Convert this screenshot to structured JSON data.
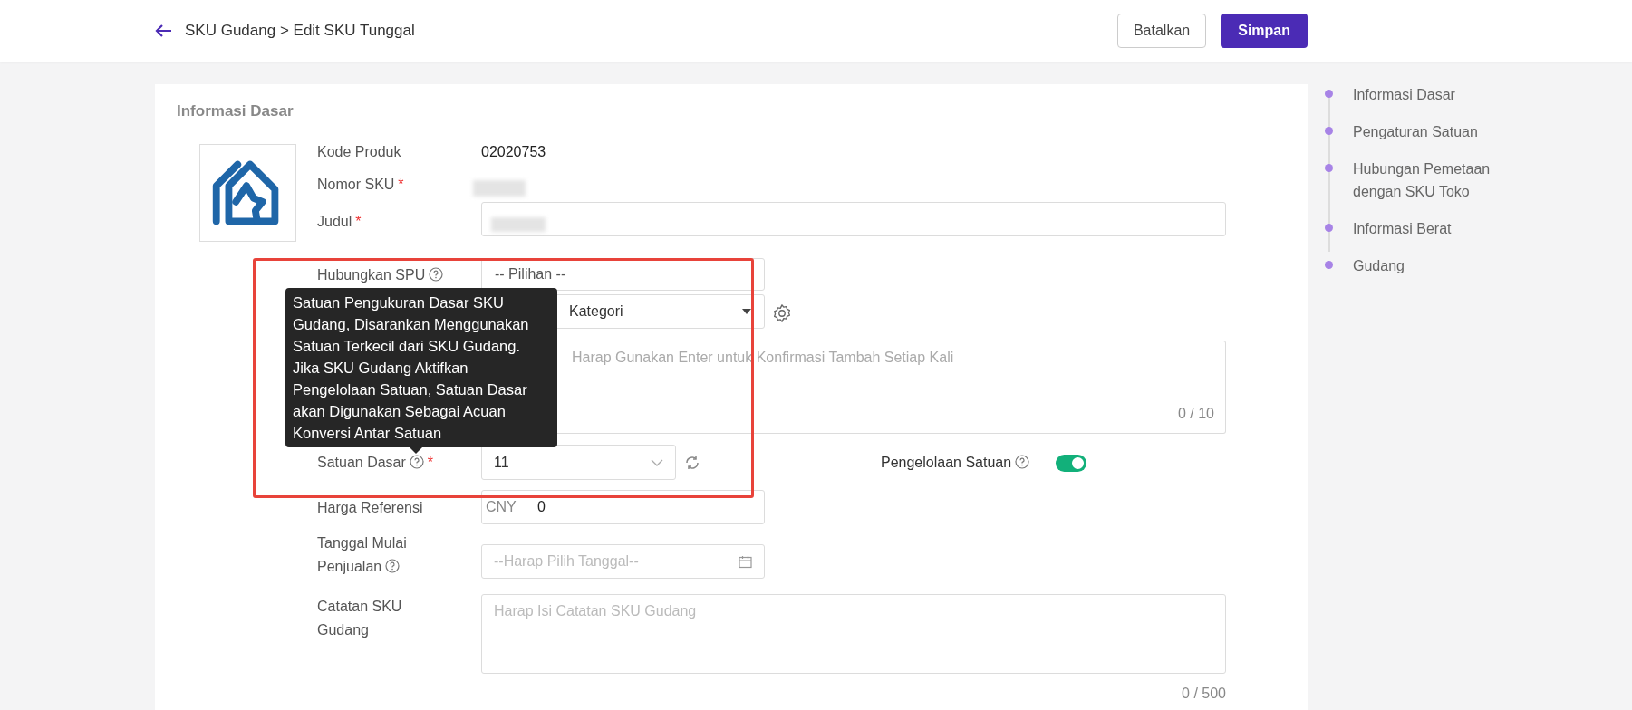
{
  "header": {
    "breadcrumb": "SKU Gudang > Edit SKU Tunggal",
    "buttons": [
      {
        "label": "Batalkan",
        "kind": "secondary"
      },
      {
        "label": "Simpan",
        "kind": "primary"
      }
    ]
  },
  "section": {
    "title": "Informasi Dasar"
  },
  "fields": [
    {
      "label": "Kode Produk",
      "kind": "text",
      "value": "02020753"
    },
    {
      "label": "Nomor SKU",
      "required": "*",
      "kind": "redacted"
    },
    {
      "label": "Judul",
      "required": "*",
      "kind": "redacted-input"
    },
    {
      "label": "Hubungkan SPU",
      "help": true,
      "kind": "input",
      "value": "-- Pilihan --"
    },
    {
      "kind": "select",
      "value": "Kategori"
    },
    {
      "kind": "textarea",
      "placeholder": "Harap Gunakan Enter untuk Konfirmasi Tambah Setiap Kali",
      "count": "0 / 10"
    },
    {
      "label": "Satuan Dasar",
      "help": true,
      "required": "*",
      "kind": "unit",
      "value": "11",
      "side_label": "Pengelolaan Satuan",
      "side_on": true
    },
    {
      "label": "Harga Referensi",
      "kind": "price",
      "prefix": "CNY",
      "value": "0"
    },
    {
      "label": "Tanggal Mulai Penjualan",
      "help": true,
      "kind": "date",
      "placeholder": "--Harap Pilih Tanggal--"
    },
    {
      "label": "Catatan SKU Gudang",
      "kind": "note",
      "placeholder": "Harap Isi Catatan SKU Gudang",
      "count": "0 / 500"
    }
  ],
  "tooltip": "Satuan Pengukuran Dasar SKU Gudang, Disarankan Menggunakan Satuan Terkecil dari SKU Gudang. Jika SKU Gudang Aktifkan Pengelolaan Satuan, Satuan Dasar akan Digunakan Sebagai Acuan Konversi Antar Satuan",
  "anchors": [
    {
      "label": "Informasi Dasar"
    },
    {
      "label": "Pengaturan Satuan"
    },
    {
      "label": "Hubungan Pemetaan dengan SKU Toko"
    },
    {
      "label": "Informasi Berat"
    },
    {
      "label": "Gudang"
    }
  ]
}
